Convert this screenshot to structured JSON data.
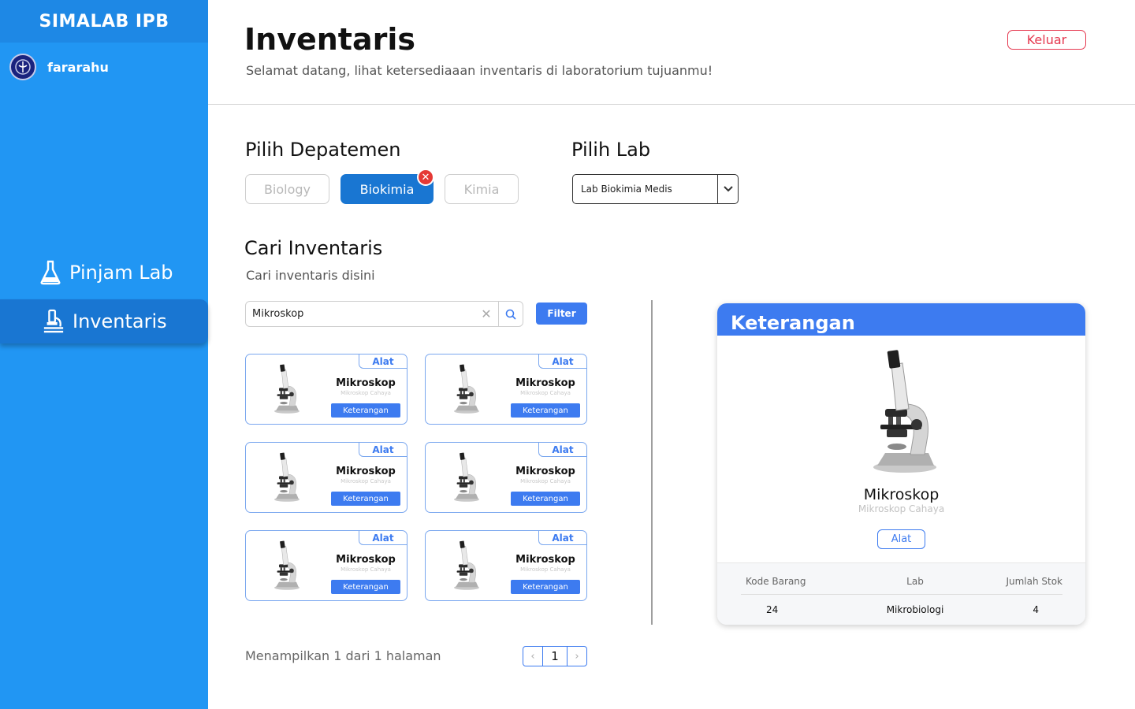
{
  "sidebar": {
    "brand": "SIMALAB IPB",
    "username": "fararahu",
    "nav": [
      {
        "label": "Pinjam Lab",
        "icon": "flask-icon",
        "active": false
      },
      {
        "label": "Inventaris",
        "icon": "microscope-icon",
        "active": true
      }
    ],
    "active_color": "#1976D2",
    "bg_color": "#2196F3"
  },
  "header": {
    "title": "Inventaris",
    "subtitle": "Selamat datang, lihat ketersediaaan inventaris di laboratorium tujuanmu!",
    "logout_label": "Keluar"
  },
  "department": {
    "title": "Pilih Depatemen",
    "options": [
      "Biology",
      "Biokimia",
      "Kimia"
    ],
    "selected": "Biokimia",
    "clear_icon": "close-icon"
  },
  "lab": {
    "title": "Pilih Lab",
    "selected": "Lab Biokimia Medis"
  },
  "search": {
    "title": "Cari Inventaris",
    "subtitle": "Cari inventaris disini",
    "value": "Mikroskop",
    "filter_label": "Filter"
  },
  "items": [
    {
      "tag": "Alat",
      "name": "Mikroskop",
      "sub": "Mikroskop Cahaya",
      "button": "Keterangan"
    },
    {
      "tag": "Alat",
      "name": "Mikroskop",
      "sub": "Mikroskop Cahaya",
      "button": "Keterangan"
    },
    {
      "tag": "Alat",
      "name": "Mikroskop",
      "sub": "Mikroskop Cahaya",
      "button": "Keterangan"
    },
    {
      "tag": "Alat",
      "name": "Mikroskop",
      "sub": "Mikroskop Cahaya",
      "button": "Keterangan"
    },
    {
      "tag": "Alat",
      "name": "Mikroskop",
      "sub": "Mikroskop Cahaya",
      "button": "Keterangan"
    },
    {
      "tag": "Alat",
      "name": "Mikroskop",
      "sub": "Mikroskop Cahaya",
      "button": "Keterangan"
    }
  ],
  "pagination": {
    "text": "Menampilkan 1 dari 1 halaman",
    "current": "1"
  },
  "detail": {
    "title": "Keterangan",
    "name": "Mikroskop",
    "sub": "Mikroskop Cahaya",
    "tag": "Alat",
    "columns": [
      "Kode Barang",
      "Lab",
      "Jumlah Stok"
    ],
    "row": [
      "24",
      "Mikrobiologi",
      "4"
    ]
  }
}
